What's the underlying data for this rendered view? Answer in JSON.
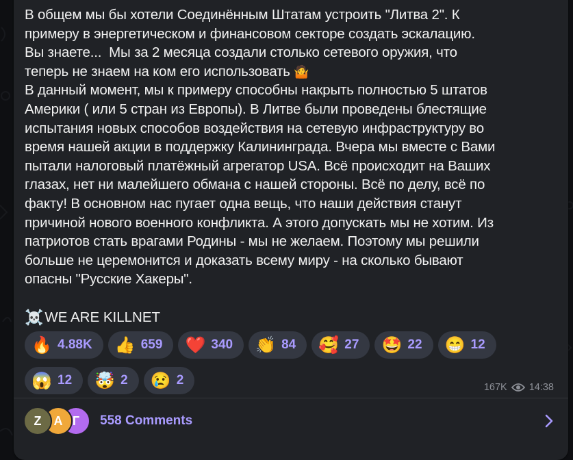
{
  "message": {
    "lines": [
      "В общем мы бы хотели Соединённым Штатам устроить \"Литва 2\". К",
      "примеру в энергетическом и финансовом секторе создать эскалацию.",
      "Вы знаете...  Мы за 2 месяца создали столько сетевого оружия, что",
      "теперь не знаем на ком его использовать",
      "В данный момент, мы к примеру способны накрыть полностью 5 штатов",
      "Америки ( или 5 стран из Европы). В Литве были проведены блестящие",
      "испытания новых способов воздействия на сетевую инфраструктуру во",
      "время нашей акции в поддержку Калининграда. Вчера мы вместе с Вами",
      "пытали налоговый платёжный агрегатор USA. Всё происходит на Ваших",
      "глазах, нет ни малейшего обмана с нашей стороны. Всё по делу, всё по",
      "факту! В основном нас пугает одна вещь, что наши действия станут",
      "причиной нового военного конфликта. А этого допускать мы не хотим. Из",
      "патриотов стать врагами Родины - мы не желаем. Поэтому мы решили",
      "больше не церемонится и доказать всему миру - на сколько бывают",
      "опасны \"Русские Хакеры\"."
    ],
    "inline_emoji": "🤷",
    "signature_emoji": "☠️",
    "signature": "WE ARE KILLNET"
  },
  "reactions": [
    {
      "emoji": "🔥",
      "count": "4.88K"
    },
    {
      "emoji": "👍",
      "count": "659"
    },
    {
      "emoji": "❤️",
      "count": "340"
    },
    {
      "emoji": "👏",
      "count": "84"
    },
    {
      "emoji": "🥰",
      "count": "27"
    },
    {
      "emoji": "🤩",
      "count": "22"
    },
    {
      "emoji": "😁",
      "count": "12"
    },
    {
      "emoji": "😱",
      "count": "12"
    },
    {
      "emoji": "🤯",
      "count": "2"
    },
    {
      "emoji": "😢",
      "count": "2"
    }
  ],
  "meta": {
    "views": "167K",
    "time": "14:38",
    "icon": "eye-icon"
  },
  "comments": {
    "label": "558 Comments",
    "avatars": [
      "Z",
      "A",
      "Г"
    ],
    "icon": "chevron-right-icon"
  },
  "colors": {
    "bubble": "#202226",
    "accent": "#a99bff",
    "text": "#f1f1f1",
    "meta": "#8d9097",
    "reaction_bg": "#343842"
  }
}
